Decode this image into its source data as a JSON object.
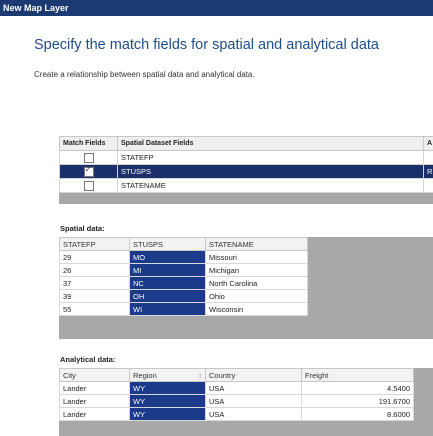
{
  "window": {
    "title": "New Map Layer"
  },
  "heading": "Specify the match fields for spatial and analytical data",
  "subtext": "Create a relationship between spatial data and analytical data.",
  "match_grid": {
    "columns": [
      "Match Fields",
      "Spatial Dataset Fields",
      "A"
    ],
    "rows": [
      {
        "checked": false,
        "field": "STATEFP",
        "analytical": ""
      },
      {
        "checked": true,
        "field": "STUSPS",
        "analytical": "R"
      },
      {
        "checked": false,
        "field": "STATENAME",
        "analytical": ""
      }
    ]
  },
  "spatial_data": {
    "label": "Spatial data:",
    "columns": [
      "STATEFP",
      "STUSPS",
      "STATENAME"
    ],
    "rows": [
      [
        "29",
        "MO",
        "Missouri"
      ],
      [
        "26",
        "MI",
        "Michigan"
      ],
      [
        "37",
        "NC",
        "North Carolina"
      ],
      [
        "39",
        "OH",
        "Ohio"
      ],
      [
        "55",
        "WI",
        "Wisconsin"
      ]
    ]
  },
  "analytical_data": {
    "label": "Analytical data:",
    "columns": [
      "City",
      "Region",
      "Country",
      "Freight"
    ],
    "sort_glyph": "↕",
    "rows": [
      [
        "Lander",
        "WY",
        "USA",
        "4.5400"
      ],
      [
        "Lander",
        "WY",
        "USA",
        "191.6700"
      ],
      [
        "Lander",
        "WY",
        "USA",
        "8.6000"
      ]
    ]
  },
  "colors": {
    "selection": "#1b2f6a",
    "highlight": "#1b3a8a",
    "heading": "#1f4e8c",
    "titlebar": "#1b3a72"
  }
}
